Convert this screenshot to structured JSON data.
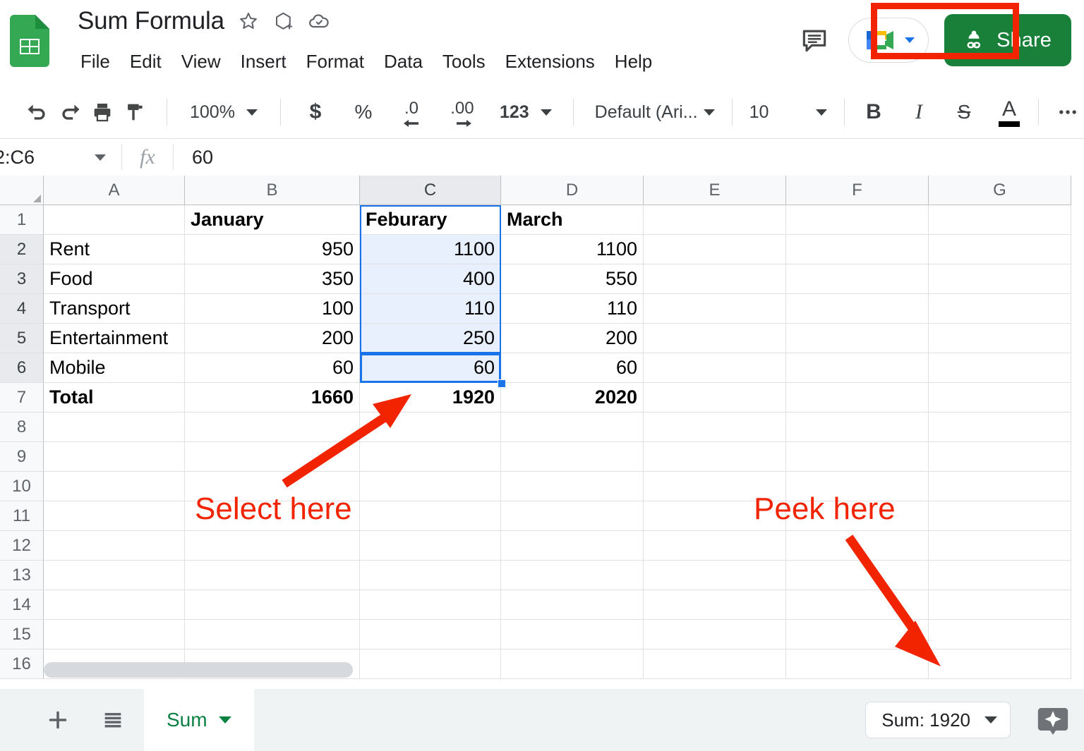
{
  "app": {
    "doc_title": "Sum Formula",
    "logo_icon": "sheets-logo-icon",
    "title_icons": [
      "star-icon",
      "move-to-folder-icon",
      "cloud-saved-icon"
    ],
    "menu": [
      "File",
      "Edit",
      "View",
      "Insert",
      "Format",
      "Data",
      "Tools",
      "Extensions",
      "Help"
    ],
    "comment_icon": "comment-icon",
    "meet_icon": "google-meet-icon",
    "share_label": "Share",
    "share_color": "#188038"
  },
  "toolbar": {
    "undo_icon": "undo-icon",
    "redo_icon": "redo-icon",
    "print_icon": "print-icon",
    "paint_icon": "paint-format-icon",
    "zoom_value": "100%",
    "currency_label": "$",
    "percent_label": "%",
    "decrease_decimal_label": ".0",
    "increase_decimal_label": ".00",
    "number_format_label": "123",
    "font_family_value": "Default (Ari...",
    "font_size_value": "10",
    "bold_label": "B",
    "italic_label": "I",
    "strike_label": "S",
    "text_color_label": "A",
    "more_label": "…"
  },
  "formula_bar": {
    "name_box_value": "2:C6",
    "fx_label": "fx",
    "formula_value": "60"
  },
  "grid": {
    "columns": [
      "A",
      "B",
      "C",
      "D",
      "E",
      "F",
      "G"
    ],
    "rows": [
      "1",
      "2",
      "3",
      "4",
      "5",
      "6",
      "7",
      "8",
      "9",
      "10",
      "11",
      "12",
      "13",
      "14",
      "15",
      "16"
    ],
    "selected_column": "C",
    "selected_rows": [
      "2",
      "3",
      "4",
      "5",
      "6"
    ],
    "active_cell": "C6",
    "selection_range": "C2:C6",
    "selection_border_color": "#1a73e8",
    "selection_fill_color": "#e8f0fe",
    "data": [
      {
        "row": "1",
        "A": "",
        "B": "January",
        "C": "Feburary",
        "D": "March",
        "bold": true,
        "align": "left"
      },
      {
        "row": "2",
        "A": "Rent",
        "B": "950",
        "C": "1100",
        "D": "1100",
        "bold": false,
        "align": "num"
      },
      {
        "row": "3",
        "A": "Food",
        "B": "350",
        "C": "400",
        "D": "550",
        "bold": false,
        "align": "num"
      },
      {
        "row": "4",
        "A": "Transport",
        "B": "100",
        "C": "110",
        "D": "110",
        "bold": false,
        "align": "num"
      },
      {
        "row": "5",
        "A": "Entertainment",
        "B": "200",
        "C": "250",
        "D": "200",
        "bold": false,
        "align": "num"
      },
      {
        "row": "6",
        "A": "Mobile",
        "B": "60",
        "C": "60",
        "D": "60",
        "bold": false,
        "align": "num"
      },
      {
        "row": "7",
        "A": "Total",
        "B": "1660",
        "C": "1920",
        "D": "2020",
        "bold": true,
        "align": "num"
      }
    ]
  },
  "bottom_bar": {
    "add_sheet_icon": "add-sheet-icon",
    "all_sheets_icon": "all-sheets-icon",
    "sheet_tab_name": "Sum",
    "sum_chip_label": "Sum: 1920",
    "sparkle_icon": "ai-assist-icon"
  },
  "annotations": {
    "color": "#f22400",
    "select_here_text": "Select here",
    "peek_here_text": "Peek here"
  }
}
